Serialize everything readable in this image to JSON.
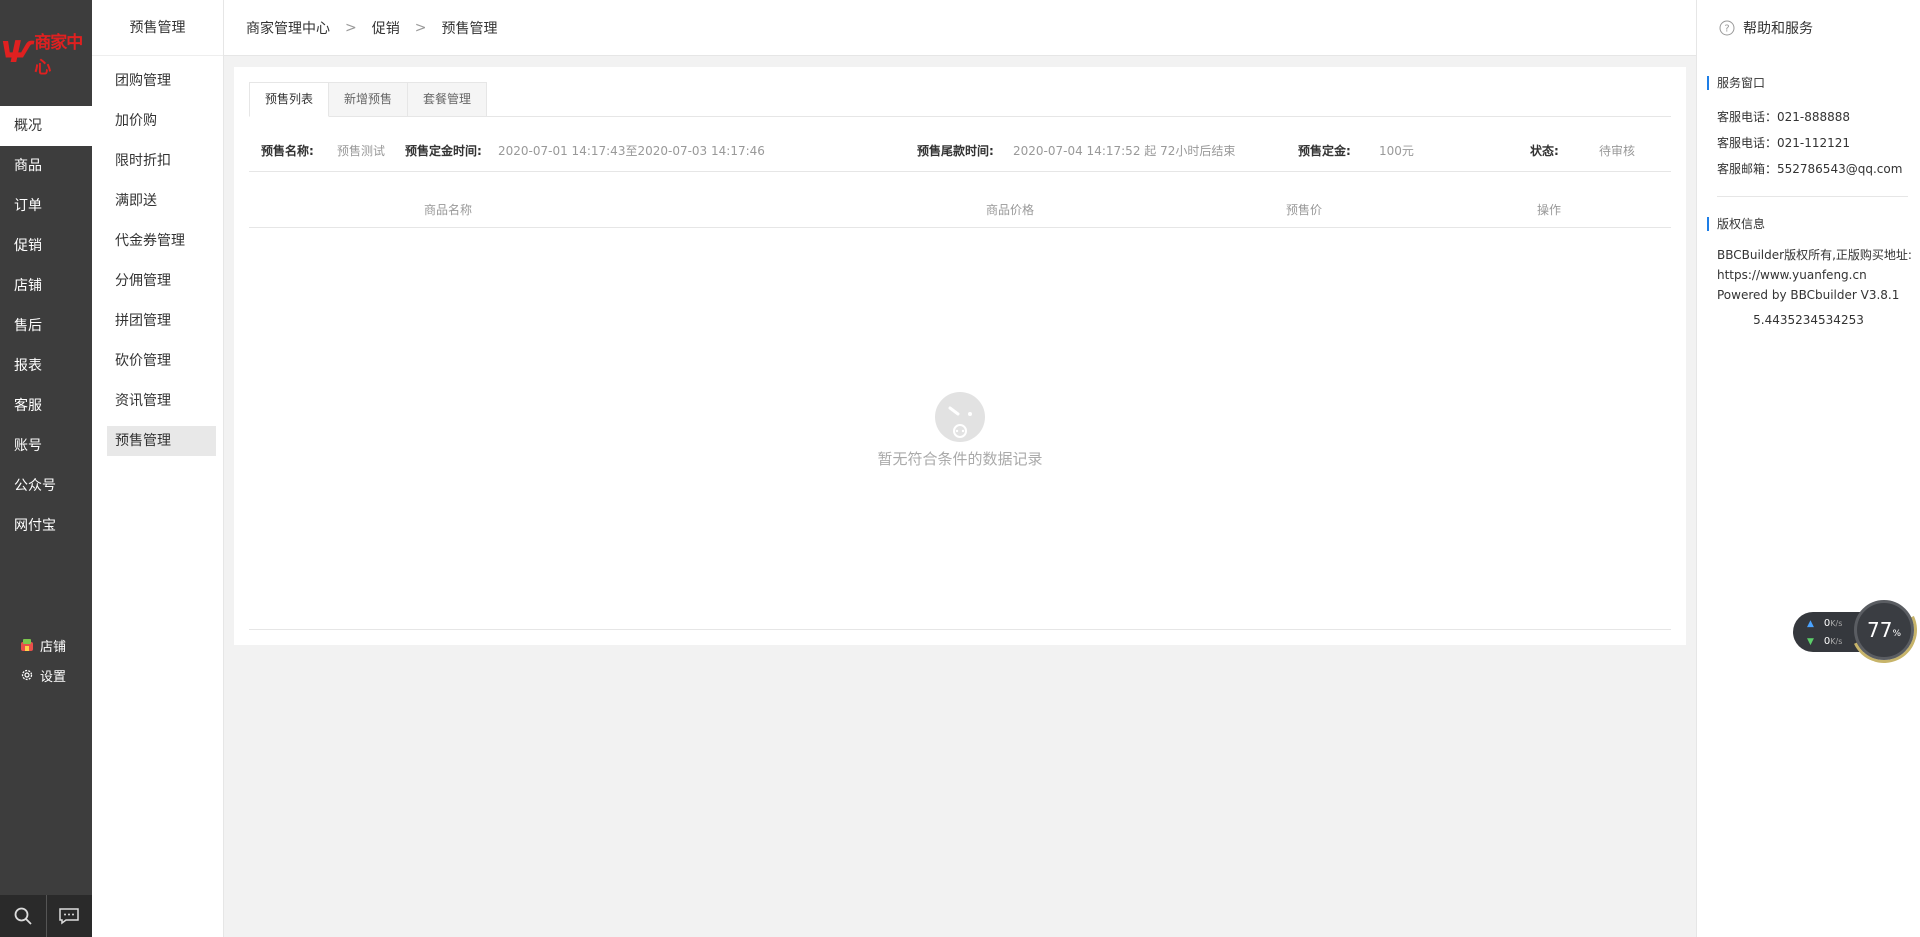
{
  "logo": {
    "text": "商家中心"
  },
  "nav": {
    "items": [
      {
        "label": "概况"
      },
      {
        "label": "商品"
      },
      {
        "label": "订单"
      },
      {
        "label": "促销"
      },
      {
        "label": "店铺"
      },
      {
        "label": "售后"
      },
      {
        "label": "报表"
      },
      {
        "label": "客服"
      },
      {
        "label": "账号"
      },
      {
        "label": "公众号"
      },
      {
        "label": "网付宝"
      }
    ],
    "active_index": 0,
    "shop_link": "店铺",
    "settings_link": "设置"
  },
  "submenu": {
    "title": "预售管理",
    "items": [
      {
        "label": "团购管理"
      },
      {
        "label": "加价购"
      },
      {
        "label": "限时折扣"
      },
      {
        "label": "满即送"
      },
      {
        "label": "代金券管理"
      },
      {
        "label": "分佣管理"
      },
      {
        "label": "拼团管理"
      },
      {
        "label": "砍价管理"
      },
      {
        "label": "资讯管理"
      },
      {
        "label": "预售管理"
      }
    ],
    "active_index": 9
  },
  "breadcrumb": {
    "items": [
      "商家管理中心",
      "促销",
      "预售管理"
    ],
    "separator": ">"
  },
  "tabs": [
    {
      "label": "预售列表"
    },
    {
      "label": "新增预售"
    },
    {
      "label": "套餐管理"
    }
  ],
  "presale_info": {
    "name_label": "预售名称:",
    "name_value": "预售测试",
    "deposit_time_label": "预售定金时间:",
    "deposit_time_value": "2020-07-01 14:17:43至2020-07-03 14:17:46",
    "final_time_label": "预售尾款时间:",
    "final_time_value": "2020-07-04 14:17:52 起 72小时后结束",
    "deposit_label": "预售定金:",
    "deposit_value": "100元",
    "status_label": "状态:",
    "status_value": "待审核"
  },
  "table": {
    "columns": [
      "商品名称",
      "商品价格",
      "预售价",
      "操作"
    ],
    "empty_text": "暂无符合条件的数据记录"
  },
  "help": {
    "title": "帮助和服务",
    "service_title": "服务窗口",
    "service_lines": [
      "客服电话：021-888888",
      "客服电话：021-112121",
      "客服邮箱：552786543@qq.com"
    ],
    "copyright_title": "版权信息",
    "copyright_line1": "BBCBuilder版权所有,正版购买地址:",
    "copyright_line2": "https://www.yuanfeng.cn",
    "copyright_line3": "Powered by BBCbuilder V3.8.1",
    "copyright_number": "5.4435234534253"
  },
  "net_widget": {
    "upload_value": "0",
    "download_value": "0",
    "unit": "K/s",
    "percent_value": "77",
    "percent_symbol": "%"
  },
  "colors": {
    "nav_bg": "#3d3d3d",
    "logo_red": "#e02020",
    "accent_blue": "#1e7ee6",
    "widget_ring": "#c7b46a"
  }
}
